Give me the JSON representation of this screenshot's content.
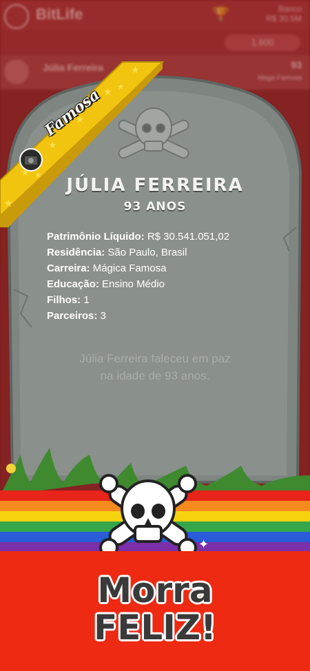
{
  "app": {
    "logo": "BitLife",
    "money_line1": "Banco",
    "money_line2": "R$ 30.5M",
    "pill": "1.600",
    "profile_name": "Júlia Ferreira",
    "profile_age": "93",
    "profile_sub": "Maga Famosa"
  },
  "badge": {
    "label": "Famosa",
    "icon": "camera-icon",
    "color": "#f1c40f"
  },
  "tombstone": {
    "name": "JÚLIA FERREIRA",
    "age": "93 ANOS",
    "facts": [
      {
        "label": "Patrimônio Líquido:",
        "value": "R$ 30.541.051,02"
      },
      {
        "label": "Residência:",
        "value": "São Paulo, Brasil"
      },
      {
        "label": "Carreira:",
        "value": "Mágica Famosa"
      },
      {
        "label": "Educação:",
        "value": "Ensino Médio"
      },
      {
        "label": "Filhos:",
        "value": "1"
      },
      {
        "label": "Parceiros:",
        "value": "3"
      }
    ],
    "epitaph_line1": "Júlia Ferreira faleceu em paz",
    "epitaph_line2": "na idade de 93 anos.",
    "skull_icon": "skull-crossbones-icon"
  },
  "banner": {
    "headline_line1": "Morra",
    "headline_line2": "FELIZ!",
    "rainbow": [
      "#e8241b",
      "#f58a1f",
      "#f6d20f",
      "#35a64a",
      "#2a5bd8",
      "#7b2fa8"
    ],
    "background": "#ee2a12"
  }
}
